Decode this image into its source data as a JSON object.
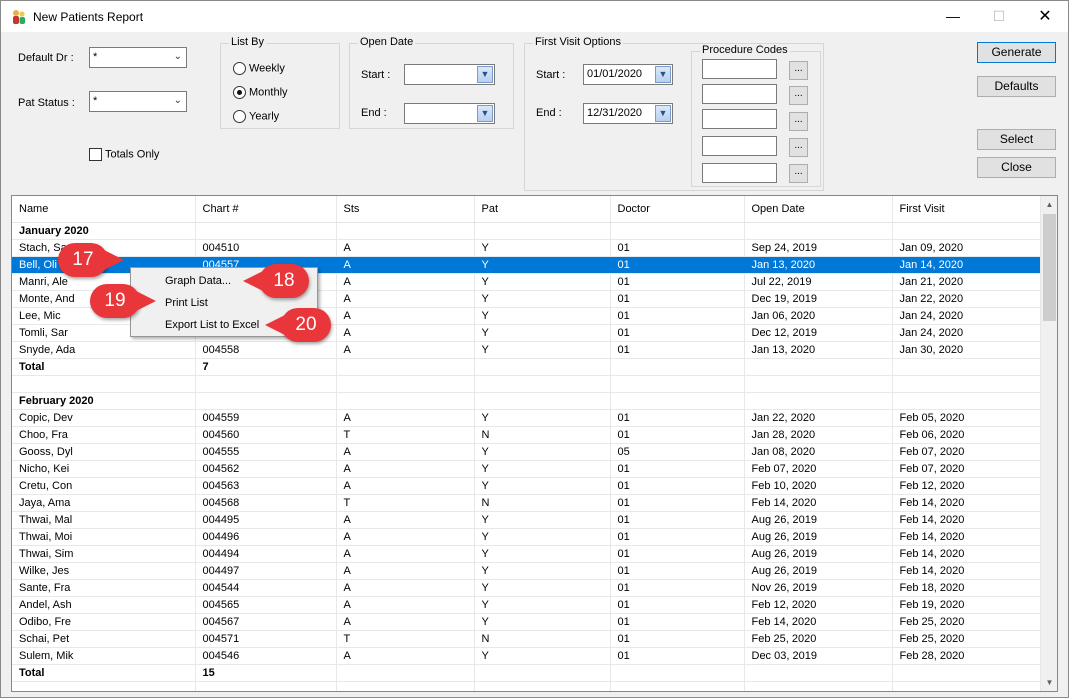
{
  "window": {
    "title": "New Patients Report",
    "close_glyph": "✕",
    "min_glyph": "—",
    "max_glyph": "☐"
  },
  "filters": {
    "default_dr_label": "Default Dr :",
    "default_dr_value": "*",
    "pat_status_label": "Pat Status :",
    "pat_status_value": "*",
    "totals_only_label": "Totals Only",
    "totals_only_checked": false
  },
  "list_by": {
    "title": "List By",
    "options": [
      {
        "label": "Weekly",
        "selected": false
      },
      {
        "label": "Monthly",
        "selected": true
      },
      {
        "label": "Yearly",
        "selected": false
      }
    ]
  },
  "open_date": {
    "title": "Open Date",
    "start_label": "Start :",
    "start_value": "",
    "end_label": "End :",
    "end_value": ""
  },
  "first_visit": {
    "title": "First Visit Options",
    "start_label": "Start :",
    "start_value": "01/01/2020",
    "end_label": "End :",
    "end_value": "12/31/2020"
  },
  "procedure_codes": {
    "title": "Procedure Codes",
    "button_label": "...",
    "values": [
      "",
      "",
      "",
      "",
      ""
    ]
  },
  "buttons": {
    "generate": "Generate",
    "defaults": "Defaults",
    "select": "Select",
    "close": "Close"
  },
  "grid": {
    "columns": [
      "Name",
      "Chart #",
      "Sts",
      "Pat",
      "Doctor",
      "Open Date",
      "First Visit"
    ],
    "rows": [
      {
        "type": "group",
        "cells": [
          "January 2020",
          "",
          "",
          "",
          "",
          "",
          ""
        ]
      },
      {
        "type": "data",
        "cells": [
          "Stach, Sa",
          "004510",
          "A",
          "Y",
          "01",
          "Sep 24, 2019",
          "Jan 09, 2020"
        ]
      },
      {
        "type": "selected",
        "cells": [
          "Bell, Oli",
          "004557",
          "A",
          "Y",
          "01",
          "Jan 13, 2020",
          "Jan 14, 2020"
        ]
      },
      {
        "type": "data",
        "cells": [
          "Manri, Ale",
          "",
          "A",
          "Y",
          "01",
          "Jul 22, 2019",
          "Jan 21, 2020"
        ]
      },
      {
        "type": "data",
        "cells": [
          "Monte, And",
          "",
          "A",
          "Y",
          "01",
          "Dec 19, 2019",
          "Jan 22, 2020"
        ]
      },
      {
        "type": "data",
        "cells": [
          "Lee, Mic",
          "",
          "A",
          "Y",
          "01",
          "Jan 06, 2020",
          "Jan 24, 2020"
        ]
      },
      {
        "type": "data",
        "cells": [
          "Tomli, Sar",
          "",
          "A",
          "Y",
          "01",
          "Dec 12, 2019",
          "Jan 24, 2020"
        ]
      },
      {
        "type": "data",
        "cells": [
          "Snyde, Ada",
          "004558",
          "A",
          "Y",
          "01",
          "Jan 13, 2020",
          "Jan 30, 2020"
        ]
      },
      {
        "type": "total",
        "cells": [
          "Total",
          "7",
          "",
          "",
          "",
          "",
          ""
        ]
      },
      {
        "type": "blank",
        "cells": [
          "",
          "",
          "",
          "",
          "",
          "",
          ""
        ]
      },
      {
        "type": "group",
        "cells": [
          "February 2020",
          "",
          "",
          "",
          "",
          "",
          ""
        ]
      },
      {
        "type": "data",
        "cells": [
          "Copic, Dev",
          "004559",
          "A",
          "Y",
          "01",
          "Jan 22, 2020",
          "Feb 05, 2020"
        ]
      },
      {
        "type": "data",
        "cells": [
          "Choo, Fra",
          "004560",
          "T",
          "N",
          "01",
          "Jan 28, 2020",
          "Feb 06, 2020"
        ]
      },
      {
        "type": "data",
        "cells": [
          "Gooss, Dyl",
          "004555",
          "A",
          "Y",
          "05",
          "Jan 08, 2020",
          "Feb 07, 2020"
        ]
      },
      {
        "type": "data",
        "cells": [
          "Nicho, Kei",
          "004562",
          "A",
          "Y",
          "01",
          "Feb 07, 2020",
          "Feb 07, 2020"
        ]
      },
      {
        "type": "data",
        "cells": [
          "Cretu, Con",
          "004563",
          "A",
          "Y",
          "01",
          "Feb 10, 2020",
          "Feb 12, 2020"
        ]
      },
      {
        "type": "data",
        "cells": [
          "Jaya, Ama",
          "004568",
          "T",
          "N",
          "01",
          "Feb 14, 2020",
          "Feb 14, 2020"
        ]
      },
      {
        "type": "data",
        "cells": [
          "Thwai, Mal",
          "004495",
          "A",
          "Y",
          "01",
          "Aug 26, 2019",
          "Feb 14, 2020"
        ]
      },
      {
        "type": "data",
        "cells": [
          "Thwai, Moi",
          "004496",
          "A",
          "Y",
          "01",
          "Aug 26, 2019",
          "Feb 14, 2020"
        ]
      },
      {
        "type": "data",
        "cells": [
          "Thwai, Sim",
          "004494",
          "A",
          "Y",
          "01",
          "Aug 26, 2019",
          "Feb 14, 2020"
        ]
      },
      {
        "type": "data",
        "cells": [
          "Wilke, Jes",
          "004497",
          "A",
          "Y",
          "01",
          "Aug 26, 2019",
          "Feb 14, 2020"
        ]
      },
      {
        "type": "data",
        "cells": [
          "Sante, Fra",
          "004544",
          "A",
          "Y",
          "01",
          "Nov 26, 2019",
          "Feb 18, 2020"
        ]
      },
      {
        "type": "data",
        "cells": [
          "Andel, Ash",
          "004565",
          "A",
          "Y",
          "01",
          "Feb 12, 2020",
          "Feb 19, 2020"
        ]
      },
      {
        "type": "data",
        "cells": [
          "Odibo, Fre",
          "004567",
          "A",
          "Y",
          "01",
          "Feb 14, 2020",
          "Feb 25, 2020"
        ]
      },
      {
        "type": "data",
        "cells": [
          "Schai, Pet",
          "004571",
          "T",
          "N",
          "01",
          "Feb 25, 2020",
          "Feb 25, 2020"
        ]
      },
      {
        "type": "data",
        "cells": [
          "Sulem, Mik",
          "004546",
          "A",
          "Y",
          "01",
          "Dec 03, 2019",
          "Feb 28, 2020"
        ]
      },
      {
        "type": "total",
        "cells": [
          "Total",
          "15",
          "",
          "",
          "",
          "",
          ""
        ]
      },
      {
        "type": "blank",
        "cells": [
          "",
          "",
          "",
          "",
          "",
          "",
          ""
        ]
      }
    ]
  },
  "context_menu": {
    "items": [
      "Graph Data...",
      "Print List",
      "Export List to Excel"
    ]
  },
  "callouts": [
    "17",
    "18",
    "19",
    "20"
  ],
  "colors": {
    "selection": "#0078d7",
    "callout": "#e8363b"
  }
}
